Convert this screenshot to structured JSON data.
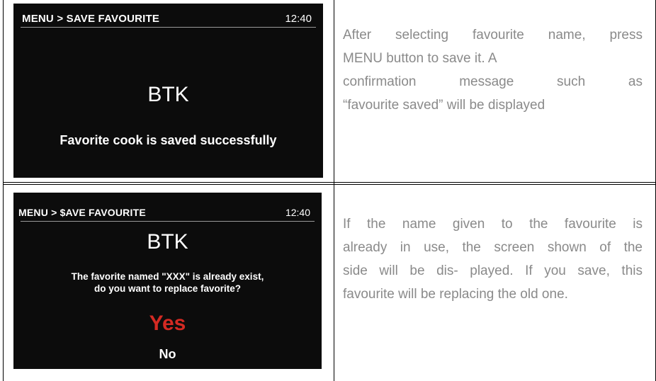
{
  "screen1": {
    "breadcrumb": "MENU > SAVE FAVOURITE",
    "clock": "12:40",
    "name": "BTK",
    "message": "Favorite cook is saved successfully"
  },
  "description1": {
    "lines": [
      "After selecting favourite name, press",
      "MENU button to save it. A",
      "confirmation message such as",
      "“favourite saved” will be displayed"
    ]
  },
  "screen2": {
    "breadcrumb": "MENU > $AVE FAVOURITE",
    "clock": "12:40",
    "name": "BTK",
    "question_line1": "The favorite named \"XXX\" is already exist,",
    "question_line2": "do you want to replace favorite?",
    "yes_option": "Yes",
    "no_option": "No",
    "yes_color": "#d42a23"
  },
  "description2": {
    "lines": [
      "If the name given to the favourite is",
      "already in use, the screen shown of the",
      "side will be dis- played. If you save, this",
      "favourite will be replacing the old one."
    ]
  }
}
